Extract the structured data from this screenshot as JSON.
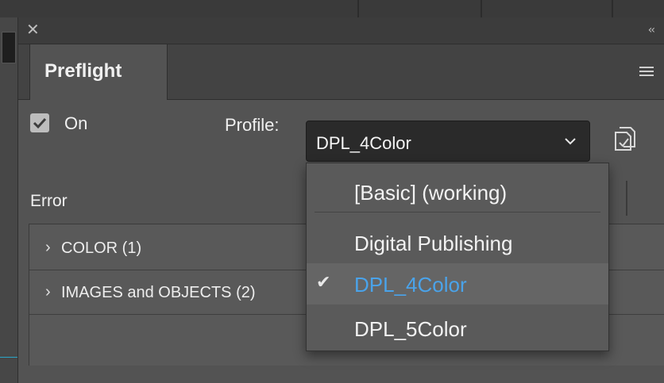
{
  "panel": {
    "tab_label": "Preflight",
    "close_glyph": "✕",
    "collapse_glyph": "‹‹"
  },
  "controls": {
    "on_label": "On",
    "on_checked": true,
    "profile_label": "Profile:",
    "profile_value": "DPL_4Color"
  },
  "list": {
    "header": "Error",
    "items": [
      {
        "label": "COLOR (1)",
        "caret": "›"
      },
      {
        "label": "IMAGES and OBJECTS (2)",
        "caret": "›"
      }
    ]
  },
  "dropdown": {
    "options": [
      {
        "label": "[Basic] (working)",
        "selected": false
      },
      {
        "label": "Digital Publishing",
        "selected": false
      },
      {
        "label": "DPL_4Color",
        "selected": true
      },
      {
        "label": "DPL_5Color",
        "selected": false
      }
    ],
    "check_glyph": "✔"
  },
  "colors": {
    "selected_text": "#4aa3ea",
    "panel_bg": "#535353",
    "select_bg": "#2a2a2a"
  },
  "icons": [
    "close-icon",
    "collapse-icon",
    "menu-icon",
    "checkmark-icon",
    "chevron-down-icon",
    "profile-options-icon",
    "chevron-right-icon"
  ]
}
